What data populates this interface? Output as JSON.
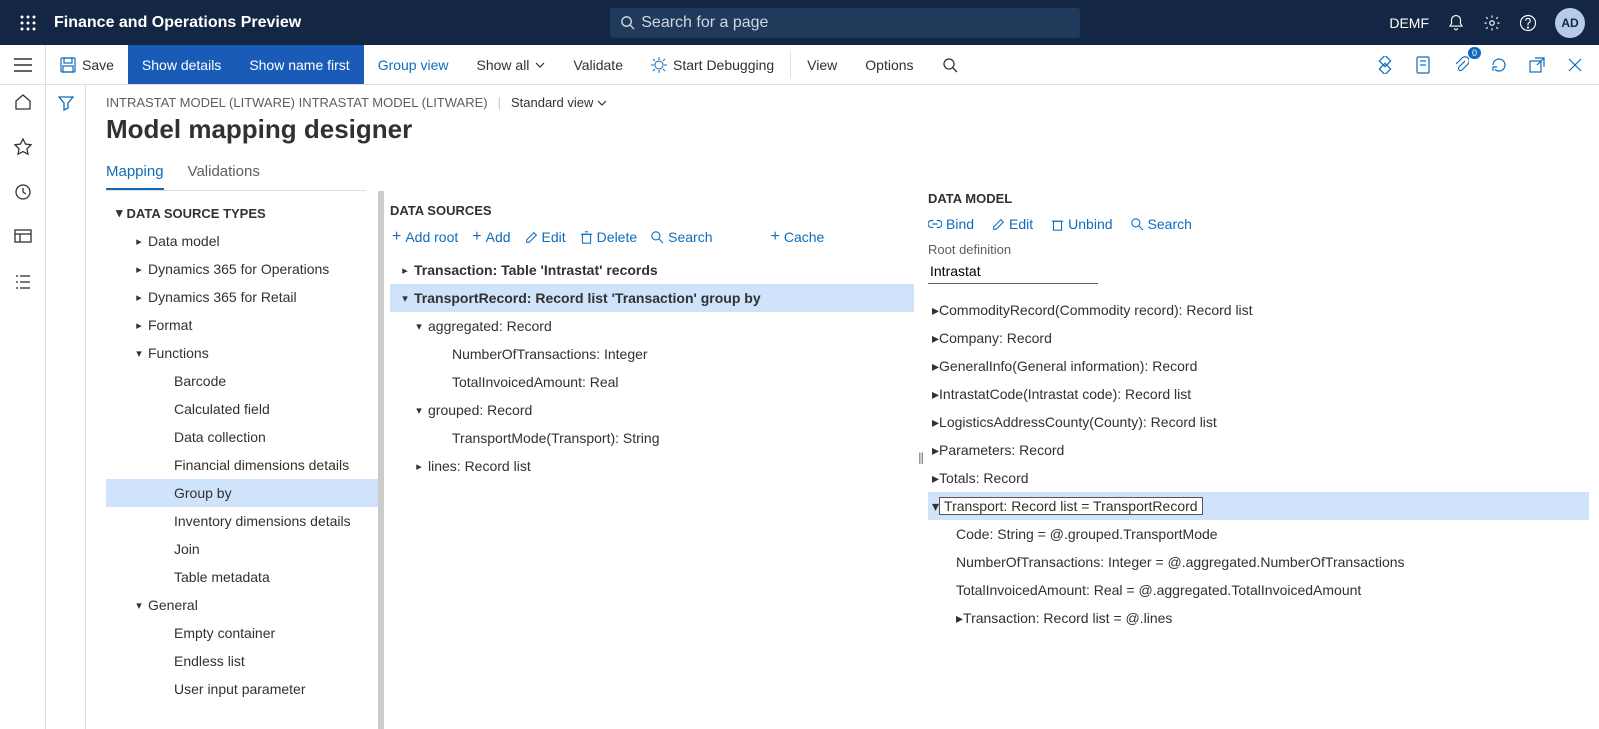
{
  "topbar": {
    "app_title": "Finance and Operations Preview",
    "search_placeholder": "Search for a page",
    "company": "DEMF",
    "avatar": "AD"
  },
  "cmdbar": {
    "save": "Save",
    "show_details": "Show details",
    "show_name_first": "Show name first",
    "group_view": "Group view",
    "show_all": "Show all",
    "validate": "Validate",
    "start_debugging": "Start Debugging",
    "view": "View",
    "options": "Options",
    "badge": "0"
  },
  "breadcrumb": {
    "path": "INTRASTAT MODEL (LITWARE) INTRASTAT MODEL (LITWARE)",
    "view": "Standard view"
  },
  "page_title": "Model mapping designer",
  "tabs": {
    "mapping": "Mapping",
    "validations": "Validations"
  },
  "col1": {
    "header": "DATA SOURCE TYPES",
    "items": [
      {
        "label": "Data model",
        "caret": "right",
        "indent": 1
      },
      {
        "label": "Dynamics 365 for Operations",
        "caret": "right",
        "indent": 1
      },
      {
        "label": "Dynamics 365 for Retail",
        "caret": "right",
        "indent": 1
      },
      {
        "label": "Format",
        "caret": "right",
        "indent": 1
      },
      {
        "label": "Functions",
        "caret": "down",
        "indent": 1
      },
      {
        "label": "Barcode",
        "caret": "none",
        "indent": 2
      },
      {
        "label": "Calculated field",
        "caret": "none",
        "indent": 2
      },
      {
        "label": "Data collection",
        "caret": "none",
        "indent": 2
      },
      {
        "label": "Financial dimensions details",
        "caret": "none",
        "indent": 2
      },
      {
        "label": "Group by",
        "caret": "none",
        "indent": 2,
        "selected": true
      },
      {
        "label": "Inventory dimensions details",
        "caret": "none",
        "indent": 2
      },
      {
        "label": "Join",
        "caret": "none",
        "indent": 2
      },
      {
        "label": "Table metadata",
        "caret": "none",
        "indent": 2
      },
      {
        "label": "General",
        "caret": "down",
        "indent": 1
      },
      {
        "label": "Empty container",
        "caret": "none",
        "indent": 2
      },
      {
        "label": "Endless list",
        "caret": "none",
        "indent": 2
      },
      {
        "label": "User input parameter",
        "caret": "none",
        "indent": 2
      }
    ]
  },
  "col2": {
    "header": "DATA SOURCES",
    "toolbar": {
      "add_root": "Add root",
      "add": "Add",
      "edit": "Edit",
      "delete": "Delete",
      "search": "Search",
      "cache": "Cache"
    },
    "items": [
      {
        "label": "Transaction: Table 'Intrastat' records",
        "caret": "right",
        "indent": 0,
        "bold": true
      },
      {
        "label": "TransportRecord: Record list 'Transaction' group by",
        "caret": "down",
        "indent": 0,
        "bold": true,
        "selected": true
      },
      {
        "label": "aggregated: Record",
        "caret": "down",
        "indent": 1
      },
      {
        "label": "NumberOfTransactions: Integer",
        "caret": "none",
        "indent": 2
      },
      {
        "label": "TotalInvoicedAmount: Real",
        "caret": "none",
        "indent": 2
      },
      {
        "label": "grouped: Record",
        "caret": "down",
        "indent": 1
      },
      {
        "label": "TransportMode(Transport): String",
        "caret": "none",
        "indent": 2
      },
      {
        "label": "lines: Record list",
        "caret": "right",
        "indent": 1
      }
    ]
  },
  "col3": {
    "header": "DATA MODEL",
    "toolbar": {
      "bind": "Bind",
      "edit": "Edit",
      "unbind": "Unbind",
      "search": "Search"
    },
    "root_label": "Root definition",
    "root_value": "Intrastat",
    "items": [
      {
        "label": "CommodityRecord(Commodity record): Record list",
        "caret": "right",
        "indent": 0
      },
      {
        "label": "Company: Record",
        "caret": "right",
        "indent": 0
      },
      {
        "label": "GeneralInfo(General information): Record",
        "caret": "right",
        "indent": 0
      },
      {
        "label": "IntrastatCode(Intrastat code): Record list",
        "caret": "right",
        "indent": 0
      },
      {
        "label": "LogisticsAddressCounty(County): Record list",
        "caret": "right",
        "indent": 0
      },
      {
        "label": "Parameters: Record",
        "caret": "right",
        "indent": 0
      },
      {
        "label": "Totals: Record",
        "caret": "right",
        "indent": 0
      },
      {
        "label": "Transport: Record list = TransportRecord",
        "caret": "down",
        "indent": 0,
        "selected": true
      },
      {
        "label": "Code: String = @.grouped.TransportMode",
        "caret": "none",
        "indent": 1
      },
      {
        "label": "NumberOfTransactions: Integer = @.aggregated.NumberOfTransactions",
        "caret": "none",
        "indent": 1
      },
      {
        "label": "TotalInvoicedAmount: Real = @.aggregated.TotalInvoicedAmount",
        "caret": "none",
        "indent": 1
      },
      {
        "label": "Transaction: Record list = @.lines",
        "caret": "right",
        "indent": 1
      }
    ]
  }
}
